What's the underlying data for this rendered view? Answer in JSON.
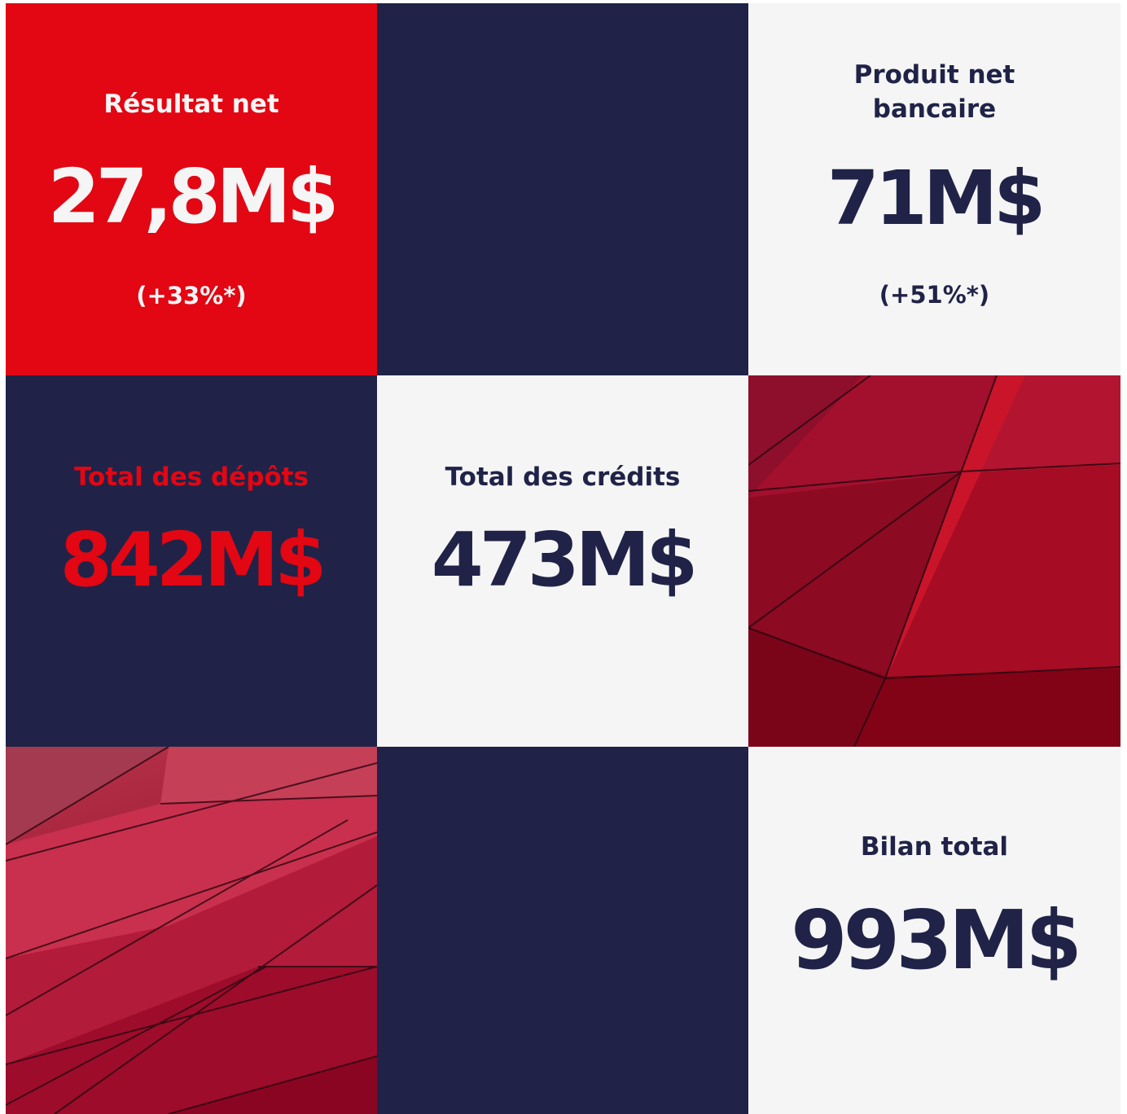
{
  "colors": {
    "accent_red": "#e30613",
    "navy": "#202347",
    "light": "#f5f5f5"
  },
  "tiles": {
    "resultat_net": {
      "label": "Résultat net",
      "value": "27,8M$",
      "change": "(+33%*)"
    },
    "produit_net_bancaire": {
      "label_line1": "Produit net",
      "label_line2": "bancaire",
      "value": "71M$",
      "change": "(+51%*)"
    },
    "total_depots": {
      "label": "Total des dépôts",
      "value": "842M$"
    },
    "total_credits": {
      "label": "Total des crédits",
      "value": "473M$"
    },
    "bilan_total": {
      "label": "Bilan total",
      "value": "993M$"
    }
  }
}
